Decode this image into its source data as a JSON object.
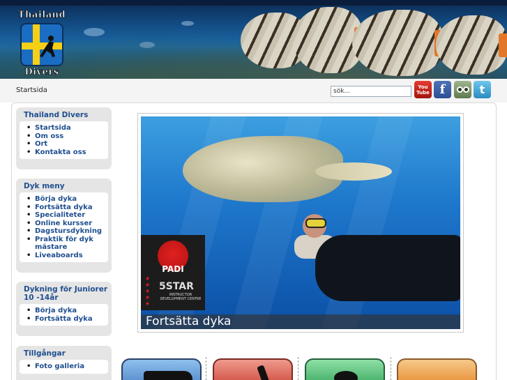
{
  "header": {
    "logo": {
      "top_text": "Thailand",
      "bottom_text": "Divers"
    }
  },
  "nav": {
    "breadcrumb": "Startsida",
    "search": {
      "value": "sök..."
    },
    "social": [
      {
        "name": "youtube",
        "label": "You Tube"
      },
      {
        "name": "facebook",
        "label": "f"
      },
      {
        "name": "tripadvisor",
        "label": ""
      },
      {
        "name": "twitter",
        "label": "t"
      }
    ]
  },
  "sidebar": {
    "boxes": [
      {
        "title": "Thailand Divers",
        "items": [
          "Startsida",
          "Om oss",
          "Ort",
          "Kontakta oss"
        ]
      },
      {
        "title": "Dyk meny",
        "items": [
          "Börja dyka",
          "Fortsätta dyka",
          "Specialiteter",
          "Online kursser",
          "Dagstursdykning",
          "Praktik för dyk mästare",
          "Liveaboards"
        ]
      },
      {
        "title": "Dykning för Juniorer 10 -14år",
        "items": [
          "Börja dyka",
          "Fortsätta dyka"
        ]
      },
      {
        "title": "Tillgångar",
        "items": [
          "Foto galleria"
        ]
      }
    ]
  },
  "hero": {
    "caption": "Fortsätta dyka",
    "badge": {
      "brand": "PADI",
      "rating": "5STAR",
      "subtitle": "INSTRUCTOR DEVELOPMENT CENTRE"
    }
  },
  "colors": {
    "link": "#1f4f8f",
    "header_bg": "#14508a",
    "tile1": "#4f86c8",
    "tile2": "#cc4a3a",
    "tile3": "#3aa860",
    "tile4": "#e58a2e"
  }
}
